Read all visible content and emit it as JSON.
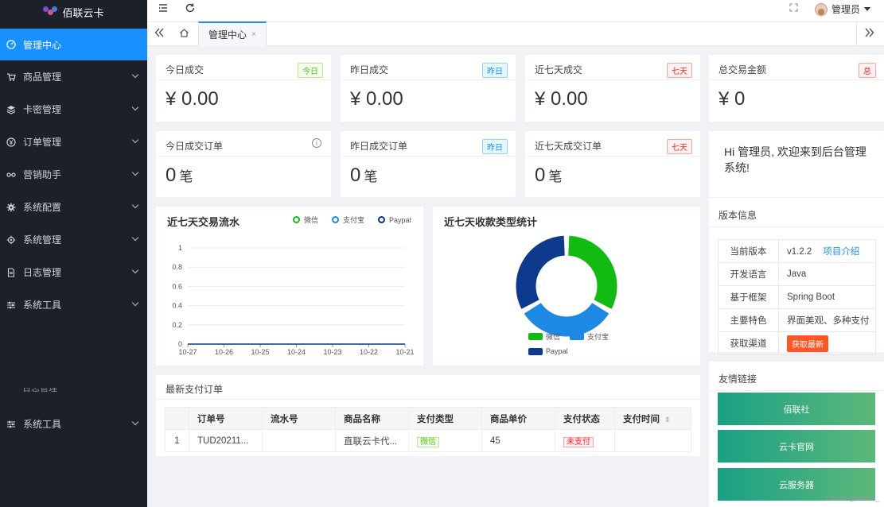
{
  "app": {
    "logo_text": "佰联云卡"
  },
  "sidebar": {
    "items": [
      {
        "label": "管理中心",
        "icon": "dashboard-icon"
      },
      {
        "label": "商品管理",
        "icon": "cart-icon"
      },
      {
        "label": "卡密管理",
        "icon": "layers-icon"
      },
      {
        "label": "订单管理",
        "icon": "yen-icon"
      },
      {
        "label": "营销助手",
        "icon": "link-icon"
      },
      {
        "label": "系统配置",
        "icon": "gear-icon"
      },
      {
        "label": "系统管理",
        "icon": "settings-icon"
      },
      {
        "label": "日志管理",
        "icon": "document-icon"
      },
      {
        "label": "系统工具",
        "icon": "sliders-icon"
      }
    ],
    "cut_label": "日志管理",
    "bottom_label": "系统工具"
  },
  "topbar": {
    "user_name": "管理员"
  },
  "tabs": {
    "active": "管理中心",
    "close": "×"
  },
  "stats": [
    {
      "label": "今日成交",
      "badge": "今日",
      "value": "¥ 0.00",
      "color": "green"
    },
    {
      "label": "昨日成交",
      "badge": "昨日",
      "value": "¥ 0.00",
      "color": "blue"
    },
    {
      "label": "近七天成交",
      "badge": "七天",
      "value": "¥ 0.00",
      "color": "red"
    },
    {
      "label": "总交易金额",
      "badge": "总",
      "value": "¥ 0",
      "color": "red"
    }
  ],
  "orders_stats": [
    {
      "label": "今日成交订单",
      "value": "0",
      "unit": "笔"
    },
    {
      "label": "昨日成交订单",
      "badge": "昨日",
      "value": "0",
      "unit": "笔"
    },
    {
      "label": "近七天成交订单",
      "badge": "七天",
      "value": "0",
      "unit": "笔"
    }
  ],
  "welcome": "Hi 管理员, 欢迎来到后台管理系统!",
  "version": {
    "title": "版本信息",
    "rows": [
      {
        "k": "当前版本",
        "v": "v1.2.2",
        "link": "项目介绍"
      },
      {
        "k": "开发语言",
        "v": "Java"
      },
      {
        "k": "基于框架",
        "v": "Spring Boot"
      },
      {
        "k": "主要特色",
        "v": "界面美观、多种支付"
      },
      {
        "k": "获取渠道",
        "button": "获取最新"
      }
    ]
  },
  "friend_links": {
    "title": "友情链接",
    "items": [
      "佰联社",
      "云卡官网",
      "云服务器"
    ]
  },
  "chart_line": {
    "title": "近七天交易流水",
    "legend": [
      "微信",
      "支付宝",
      "Paypal"
    ]
  },
  "chart_pie": {
    "title": "近七天收款类型统计",
    "legend": [
      "微信",
      "支付宝",
      "Paypal"
    ]
  },
  "chart_data": [
    {
      "type": "line",
      "title": "近七天交易流水",
      "categories": [
        "10-27",
        "10-26",
        "10-25",
        "10-24",
        "10-23",
        "10-22",
        "10-21"
      ],
      "series": [
        {
          "name": "微信",
          "values": [
            0,
            0,
            0,
            0,
            0,
            0,
            0
          ],
          "color": "#11bb11"
        },
        {
          "name": "支付宝",
          "values": [
            0,
            0,
            0,
            0,
            0,
            0,
            0
          ],
          "color": "#1e88e5"
        },
        {
          "name": "Paypal",
          "values": [
            0,
            0,
            0,
            0,
            0,
            0,
            0
          ],
          "color": "#0d2d80"
        }
      ],
      "yticks": [
        "0",
        "0.2",
        "0.4",
        "0.6",
        "0.8",
        "1"
      ],
      "ylim": [
        0,
        1
      ],
      "legend_position": "top-right"
    },
    {
      "type": "pie",
      "title": "近七天收款类型统计",
      "labels": [
        "微信",
        "支付宝",
        "Paypal"
      ],
      "values": [
        1,
        1,
        1
      ],
      "colors": [
        "#11bb11",
        "#1e88e5",
        "#0d3a8c"
      ],
      "legend_position": "bottom"
    }
  ],
  "orders": {
    "title": "最新支付订单",
    "headers": [
      "",
      "订单号",
      "流水号",
      "商品名称",
      "支付类型",
      "商品单价",
      "支付状态",
      "支付时间"
    ],
    "rows": [
      {
        "idx": "1",
        "order_no": "TUD20211...",
        "serial": "",
        "product": "直联云卡代...",
        "pay_type": "微信",
        "price": "45",
        "status": "未支付",
        "time": ""
      }
    ]
  },
  "watermark": "CSDN @weixin_"
}
